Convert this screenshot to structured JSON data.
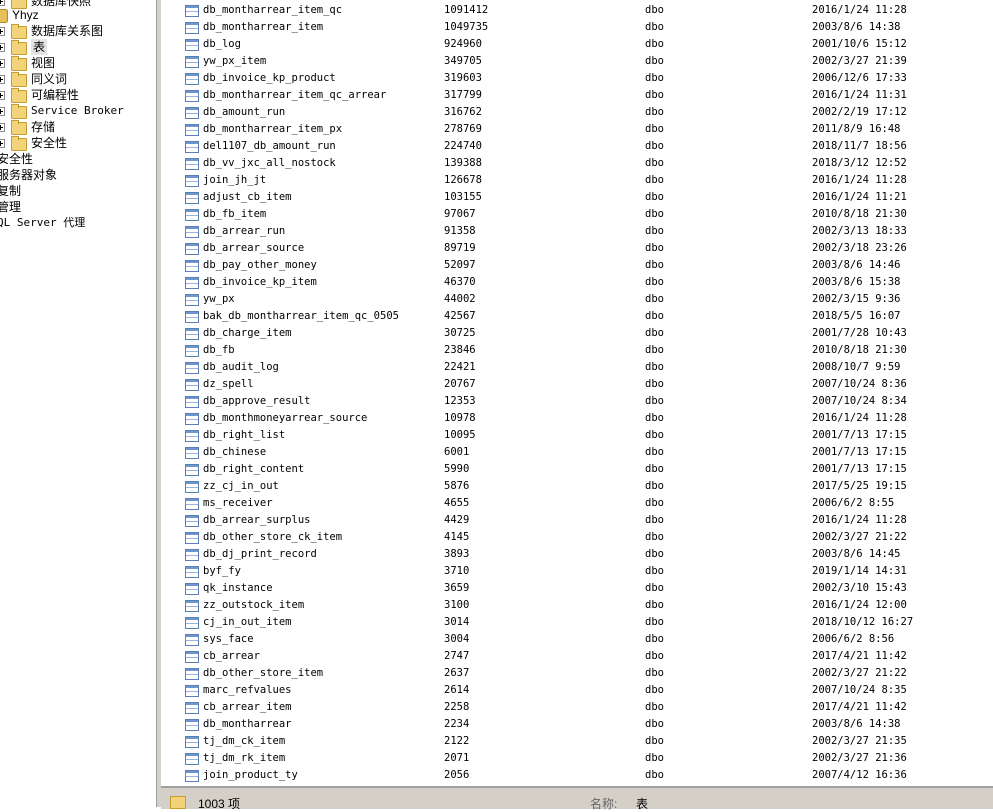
{
  "tree": {
    "top_partial": "数据库快照",
    "db_name": "Yhyz",
    "children": [
      "数据库关系图",
      "表",
      "视图",
      "同义词",
      "可编程性",
      "Service Broker",
      "存储",
      "安全性"
    ],
    "server_nodes": [
      "安全性",
      "服务器对象",
      "复制",
      "管理",
      "QL Server 代理"
    ]
  },
  "table": {
    "rows": [
      {
        "name": "db_montharrear_item_qc",
        "rows": "1091412",
        "schema": "dbo",
        "date": "2016/1/24 11:28"
      },
      {
        "name": "db_montharrear_item",
        "rows": "1049735",
        "schema": "dbo",
        "date": "2003/8/6 14:38"
      },
      {
        "name": "db_log",
        "rows": "924960",
        "schema": "dbo",
        "date": "2001/10/6 15:12"
      },
      {
        "name": "yw_px_item",
        "rows": "349705",
        "schema": "dbo",
        "date": "2002/3/27 21:39"
      },
      {
        "name": "db_invoice_kp_product",
        "rows": "319603",
        "schema": "dbo",
        "date": "2006/12/6 17:33"
      },
      {
        "name": "db_montharrear_item_qc_arrear",
        "rows": "317799",
        "schema": "dbo",
        "date": "2016/1/24 11:31"
      },
      {
        "name": "db_amount_run",
        "rows": "316762",
        "schema": "dbo",
        "date": "2002/2/19 17:12"
      },
      {
        "name": "db_montharrear_item_px",
        "rows": "278769",
        "schema": "dbo",
        "date": "2011/8/9 16:48"
      },
      {
        "name": "del1107_db_amount_run",
        "rows": "224740",
        "schema": "dbo",
        "date": "2018/11/7 18:56"
      },
      {
        "name": "db_vv_jxc_all_nostock",
        "rows": "139388",
        "schema": "dbo",
        "date": "2018/3/12 12:52"
      },
      {
        "name": "join_jh_jt",
        "rows": "126678",
        "schema": "dbo",
        "date": "2016/1/24 11:28"
      },
      {
        "name": "adjust_cb_item",
        "rows": "103155",
        "schema": "dbo",
        "date": "2016/1/24 11:21"
      },
      {
        "name": "db_fb_item",
        "rows": "97067",
        "schema": "dbo",
        "date": "2010/8/18 21:30"
      },
      {
        "name": "db_arrear_run",
        "rows": "91358",
        "schema": "dbo",
        "date": "2002/3/13 18:33"
      },
      {
        "name": "db_arrear_source",
        "rows": "89719",
        "schema": "dbo",
        "date": "2002/3/18 23:26"
      },
      {
        "name": "db_pay_other_money",
        "rows": "52097",
        "schema": "dbo",
        "date": "2003/8/6 14:46"
      },
      {
        "name": "db_invoice_kp_item",
        "rows": "46370",
        "schema": "dbo",
        "date": "2003/8/6 15:38"
      },
      {
        "name": "yw_px",
        "rows": "44002",
        "schema": "dbo",
        "date": "2002/3/15 9:36"
      },
      {
        "name": "bak_db_montharrear_item_qc_0505",
        "rows": "42567",
        "schema": "dbo",
        "date": "2018/5/5 16:07"
      },
      {
        "name": "db_charge_item",
        "rows": "30725",
        "schema": "dbo",
        "date": "2001/7/28 10:43"
      },
      {
        "name": "db_fb",
        "rows": "23846",
        "schema": "dbo",
        "date": "2010/8/18 21:30"
      },
      {
        "name": "db_audit_log",
        "rows": "22421",
        "schema": "dbo",
        "date": "2008/10/7 9:59"
      },
      {
        "name": "dz_spell",
        "rows": "20767",
        "schema": "dbo",
        "date": "2007/10/24 8:36"
      },
      {
        "name": "db_approve_result",
        "rows": "12353",
        "schema": "dbo",
        "date": "2007/10/24 8:34"
      },
      {
        "name": "db_monthmoneyarrear_source",
        "rows": "10978",
        "schema": "dbo",
        "date": "2016/1/24 11:28"
      },
      {
        "name": "db_right_list",
        "rows": "10095",
        "schema": "dbo",
        "date": "2001/7/13 17:15"
      },
      {
        "name": "db_chinese",
        "rows": "6001",
        "schema": "dbo",
        "date": "2001/7/13 17:15"
      },
      {
        "name": "db_right_content",
        "rows": "5990",
        "schema": "dbo",
        "date": "2001/7/13 17:15"
      },
      {
        "name": "zz_cj_in_out",
        "rows": "5876",
        "schema": "dbo",
        "date": "2017/5/25 19:15"
      },
      {
        "name": "ms_receiver",
        "rows": "4655",
        "schema": "dbo",
        "date": "2006/6/2 8:55"
      },
      {
        "name": "db_arrear_surplus",
        "rows": "4429",
        "schema": "dbo",
        "date": "2016/1/24 11:28"
      },
      {
        "name": "db_other_store_ck_item",
        "rows": "4145",
        "schema": "dbo",
        "date": "2002/3/27 21:22"
      },
      {
        "name": "db_dj_print_record",
        "rows": "3893",
        "schema": "dbo",
        "date": "2003/8/6 14:45"
      },
      {
        "name": "byf_fy",
        "rows": "3710",
        "schema": "dbo",
        "date": "2019/1/14 14:31"
      },
      {
        "name": "qk_instance",
        "rows": "3659",
        "schema": "dbo",
        "date": "2002/3/10 15:43"
      },
      {
        "name": "zz_outstock_item",
        "rows": "3100",
        "schema": "dbo",
        "date": "2016/1/24 12:00"
      },
      {
        "name": "cj_in_out_item",
        "rows": "3014",
        "schema": "dbo",
        "date": "2018/10/12 16:27"
      },
      {
        "name": "sys_face",
        "rows": "3004",
        "schema": "dbo",
        "date": "2006/6/2 8:56"
      },
      {
        "name": "cb_arrear",
        "rows": "2747",
        "schema": "dbo",
        "date": "2017/4/21 11:42"
      },
      {
        "name": "db_other_store_item",
        "rows": "2637",
        "schema": "dbo",
        "date": "2002/3/27 21:22"
      },
      {
        "name": "marc_refvalues",
        "rows": "2614",
        "schema": "dbo",
        "date": "2007/10/24 8:35"
      },
      {
        "name": "cb_arrear_item",
        "rows": "2258",
        "schema": "dbo",
        "date": "2017/4/21 11:42"
      },
      {
        "name": "db_montharrear",
        "rows": "2234",
        "schema": "dbo",
        "date": "2003/8/6 14:38"
      },
      {
        "name": "tj_dm_ck_item",
        "rows": "2122",
        "schema": "dbo",
        "date": "2002/3/27 21:35"
      },
      {
        "name": "tj_dm_rk_item",
        "rows": "2071",
        "schema": "dbo",
        "date": "2002/3/27 21:36"
      },
      {
        "name": "join_product_ty",
        "rows": "2056",
        "schema": "dbo",
        "date": "2007/4/12 16:36"
      }
    ]
  },
  "status": {
    "count": "1003 项",
    "name_label": "名称:",
    "name_value": "表"
  }
}
